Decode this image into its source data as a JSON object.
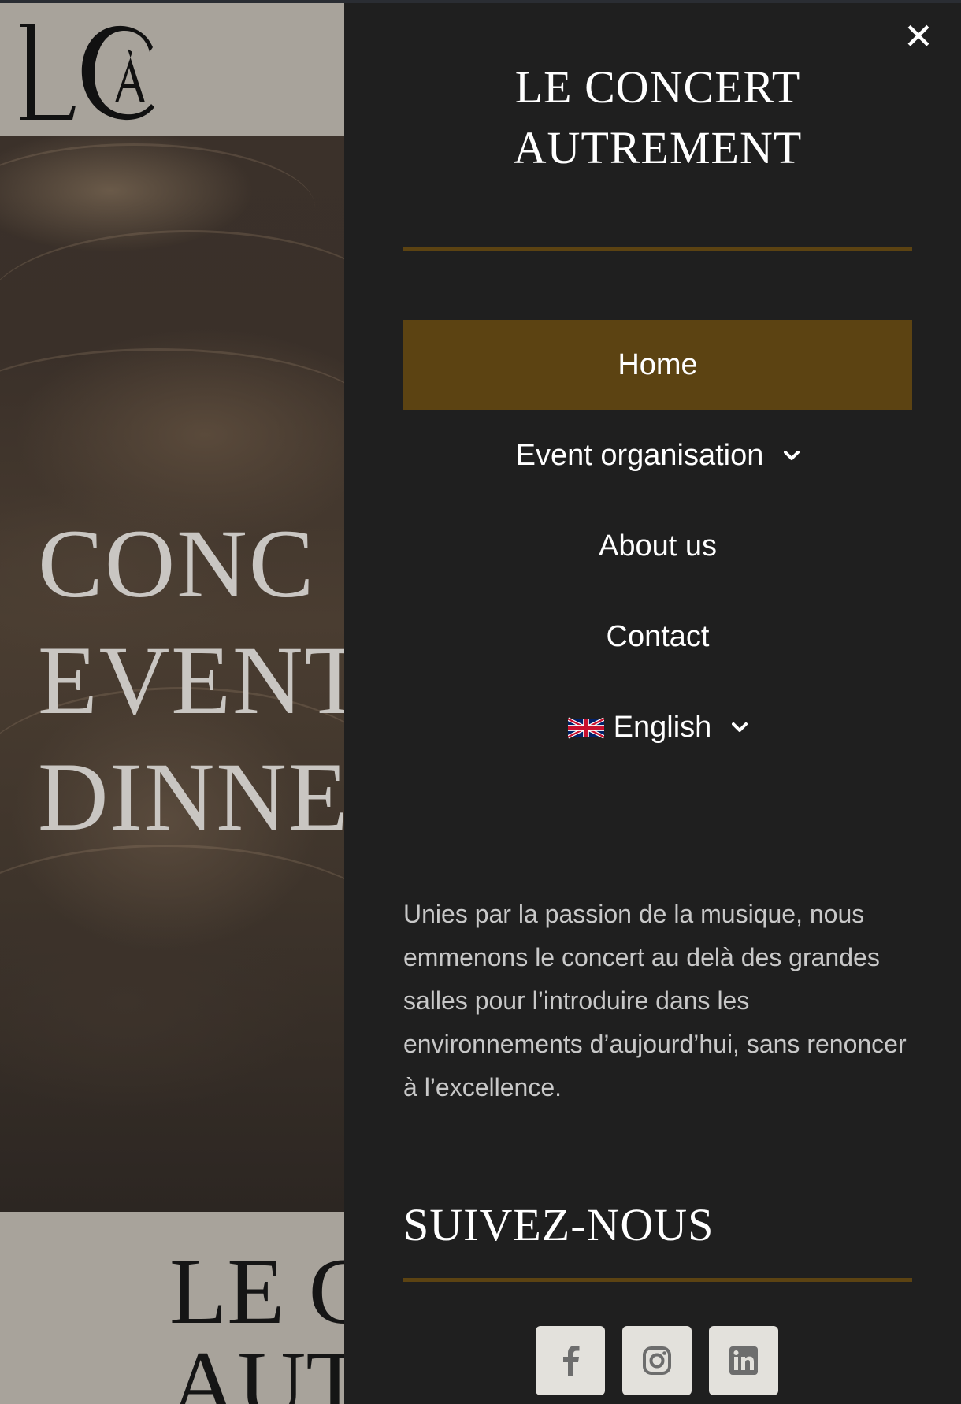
{
  "background_page": {
    "logo_text": "LCA",
    "hero_title": "CONC\nEVENT\nDINNE",
    "footer_title": "LE C\nAUT"
  },
  "menu": {
    "close_label": "✕",
    "title": "LE CONCERT AUTREMENT",
    "items": [
      {
        "label": "Home",
        "active": true
      },
      {
        "label": "Event organisation",
        "has_submenu": true
      },
      {
        "label": "About us"
      },
      {
        "label": "Contact"
      }
    ],
    "language": {
      "label": "English",
      "flag": "uk-flag-icon"
    },
    "description": "Unies par la passion de la musique, nous emmenons le concert au delà des grandes salles pour l’introduire dans les environnements d’aujourd’hui, sans renoncer à l’excellence.",
    "follow_title": "SUIVEZ-NOUS",
    "social": [
      "facebook-icon",
      "instagram-icon",
      "linkedin-icon"
    ]
  },
  "colors": {
    "panel_bg": "#1f1f1f",
    "accent": "#5c4312",
    "header_bg": "#a8a39b",
    "social_bg": "#e3e1dc"
  }
}
